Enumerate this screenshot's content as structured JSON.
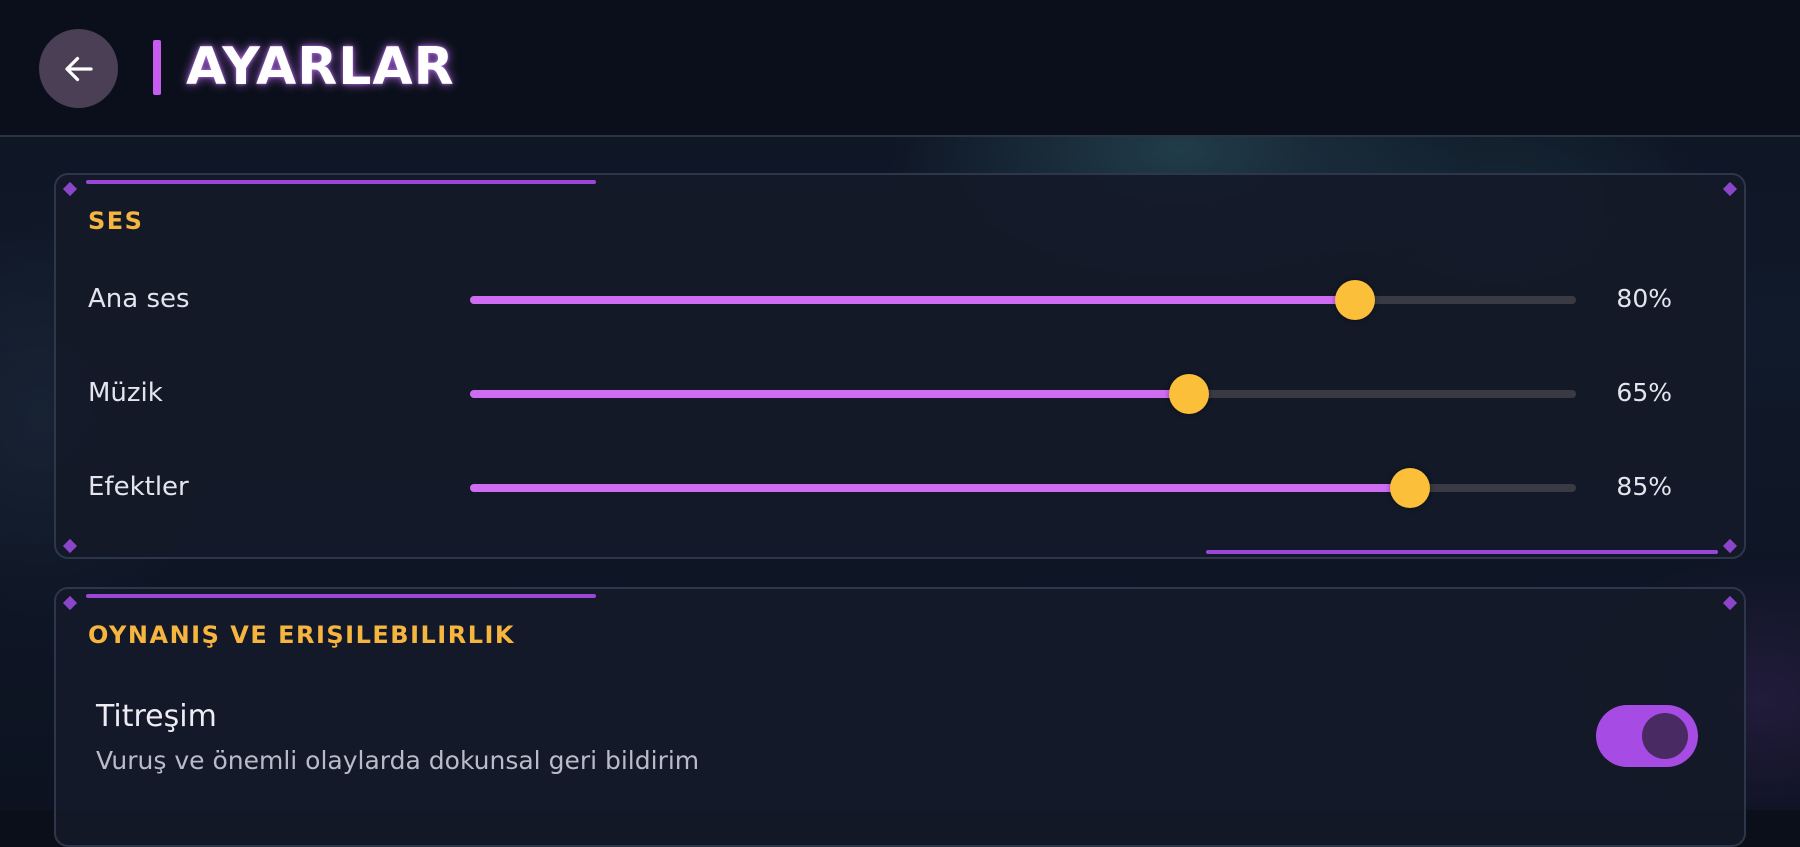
{
  "header": {
    "back_icon": "arrow-left-icon",
    "title": "AYARLAR"
  },
  "colors": {
    "accent_purple": "#c65cf0",
    "slider_fill": "#d06cf4",
    "thumb_yellow": "#fbbf3a",
    "section_title": "#f5b53f",
    "toggle_on": "#a64be3"
  },
  "sound": {
    "title": "SES",
    "sliders": [
      {
        "label": "Ana ses",
        "value": 80,
        "value_text": "80%"
      },
      {
        "label": "Müzik",
        "value": 65,
        "value_text": "65%"
      },
      {
        "label": "Efektler",
        "value": 85,
        "value_text": "85%"
      }
    ]
  },
  "gameplay": {
    "title": "OYNANIŞ VE ERIŞILEBILIRLIK",
    "vibration": {
      "label": "Titreşim",
      "description": "Vuruş ve önemli olaylarda dokunsal geri bildirim",
      "enabled": true
    }
  }
}
